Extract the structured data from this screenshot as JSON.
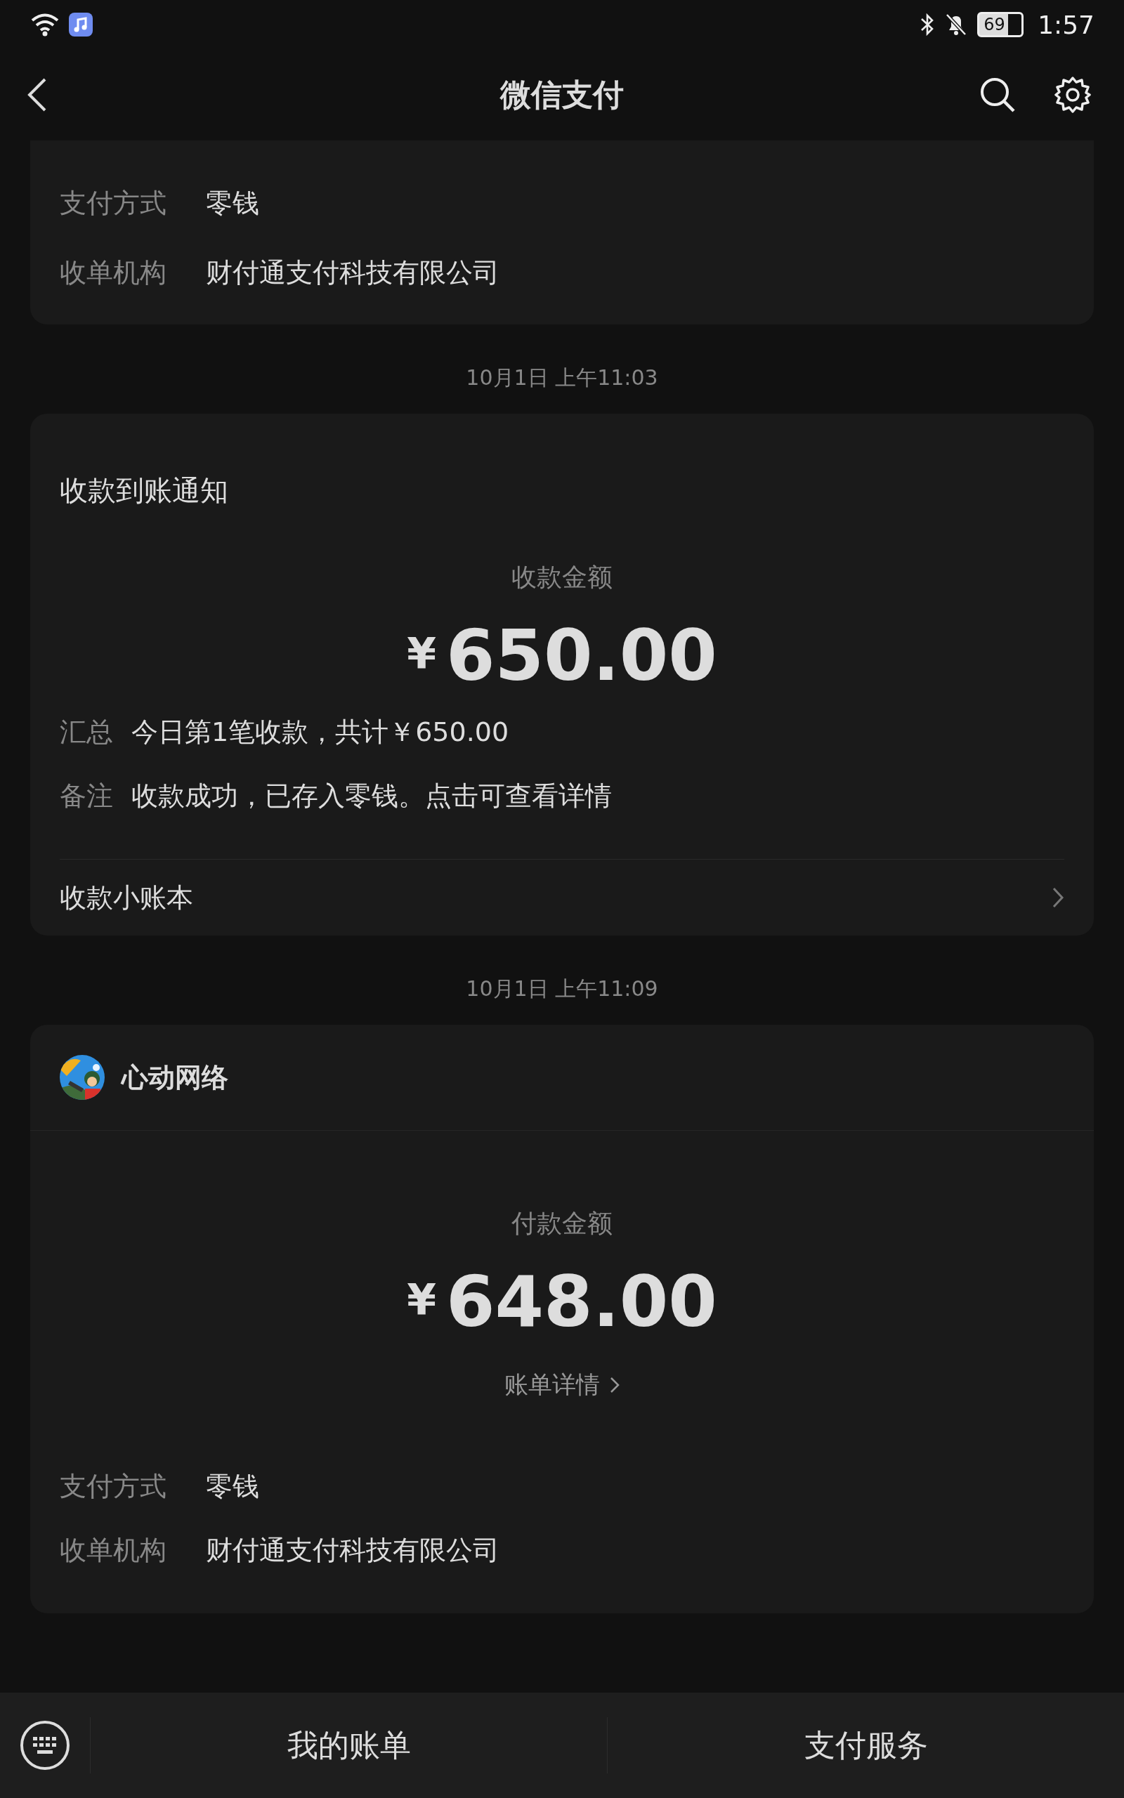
{
  "status_bar": {
    "battery": "69",
    "time": "1:57"
  },
  "header": {
    "title": "微信支付"
  },
  "messages": [
    {
      "kind": "payment_tail",
      "details": [
        {
          "label": "支付方式",
          "value": "零钱"
        },
        {
          "label": "收单机构",
          "value": "财付通支付科技有限公司"
        }
      ]
    },
    {
      "kind": "receipt",
      "time": "10月1日 上午11:03",
      "title": "收款到账通知",
      "amount_label": "收款金额",
      "currency": "¥",
      "amount": "650.00",
      "details": [
        {
          "label": "汇总",
          "value": "今日第1笔收款，共计￥650.00"
        },
        {
          "label": "备注",
          "value": "收款成功，已存入零钱。点击可查看详情"
        }
      ],
      "footer_link": "收款小账本"
    },
    {
      "kind": "payment",
      "time": "10月1日 上午11:09",
      "merchant": "心动网络",
      "amount_label": "付款金额",
      "currency": "¥",
      "amount": "648.00",
      "link": "账单详情",
      "details": [
        {
          "label": "支付方式",
          "value": "零钱"
        },
        {
          "label": "收单机构",
          "value": "财付通支付科技有限公司"
        }
      ]
    }
  ],
  "bottom_bar": {
    "tabs": [
      "我的账单",
      "支付服务"
    ]
  }
}
